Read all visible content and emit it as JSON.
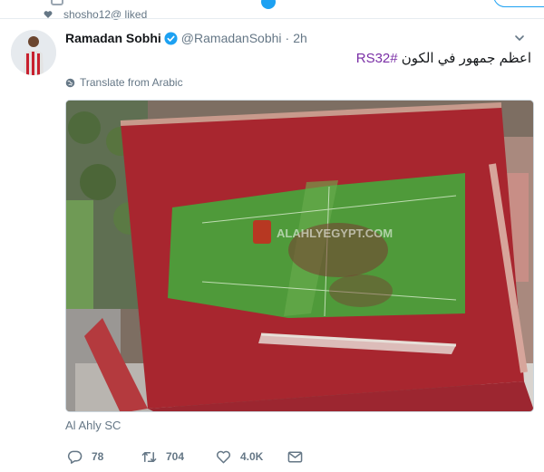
{
  "context": {
    "text": "shosho12@ liked",
    "icon": "heart-icon"
  },
  "tweet": {
    "author_name": "Ramadan Sobhi",
    "verified": true,
    "handle": "@RamadanSobhi",
    "separator": "·",
    "time": "2h",
    "text_main": "اعظم جمهور في الكون",
    "hashtag": "#RS32",
    "translate_label": "Translate from Arabic",
    "media_watermark": "ALAHLYEGYPT.COM",
    "media_caption": "Al Ahly SC"
  },
  "actions": {
    "reply_count": "78",
    "retweet_count": "704",
    "like_count": "4.0K"
  },
  "colors": {
    "accent": "#1da1f2",
    "hashtag": "#7a2fa6",
    "muted_text": "#657786",
    "crowd_red": "#a8262f",
    "pitch_green": "#4f9a3a"
  }
}
